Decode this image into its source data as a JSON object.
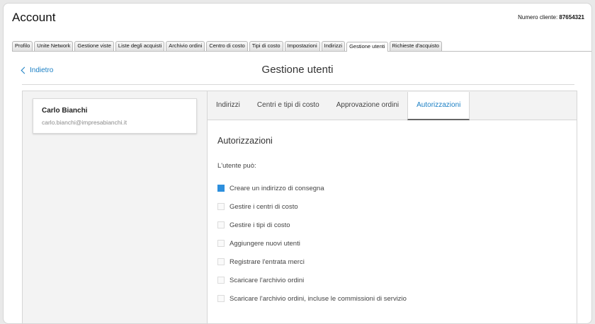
{
  "app": {
    "title": "Account",
    "client_label": "Numero cliente:",
    "client_number": "87654321"
  },
  "tabs": [
    {
      "label": "Profilo",
      "active": false
    },
    {
      "label": "Unite Network",
      "active": false
    },
    {
      "label": "Gestione viste",
      "active": false
    },
    {
      "label": "Liste degli acquisti",
      "active": false
    },
    {
      "label": "Archivio ordini",
      "active": false
    },
    {
      "label": "Centro di costo",
      "active": false
    },
    {
      "label": "Tipi di costo",
      "active": false
    },
    {
      "label": "Impostazioni",
      "active": false
    },
    {
      "label": "Indirizzi",
      "active": false
    },
    {
      "label": "Gestione utenti",
      "active": true
    },
    {
      "label": "Richieste d'acquisto",
      "active": false
    }
  ],
  "header": {
    "back_label": "Indietro",
    "page_title": "Gestione utenti",
    "back_icon": "chevron-left-icon"
  },
  "user": {
    "name": "Carlo Bianchi",
    "email": "carlo.bianchi@impresabianchi.it"
  },
  "subtabs": [
    {
      "label": "Indirizzi",
      "active": false
    },
    {
      "label": "Centri e tipi di costo",
      "active": false
    },
    {
      "label": "Approvazione ordini",
      "active": false
    },
    {
      "label": "Autorizzazioni",
      "active": true
    }
  ],
  "permissions": {
    "title": "Autorizzazioni",
    "lead": "L'utente può:",
    "items": [
      {
        "label": "Creare un indirizzo di consegna",
        "checked": true
      },
      {
        "label": "Gestire i centri di costo",
        "checked": false
      },
      {
        "label": "Gestire i tipi di costo",
        "checked": false
      },
      {
        "label": "Aggiungere nuovi utenti",
        "checked": false
      },
      {
        "label": "Registrare l'entrata merci",
        "checked": false
      },
      {
        "label": "Scaricare l'archivio ordini",
        "checked": false
      },
      {
        "label": "Scaricare l'archivio ordini, incluse le commissioni di servizio",
        "checked": false
      }
    ]
  },
  "colors": {
    "accent": "#1a7fc4",
    "checkbox_checked": "#2d8fdd"
  }
}
